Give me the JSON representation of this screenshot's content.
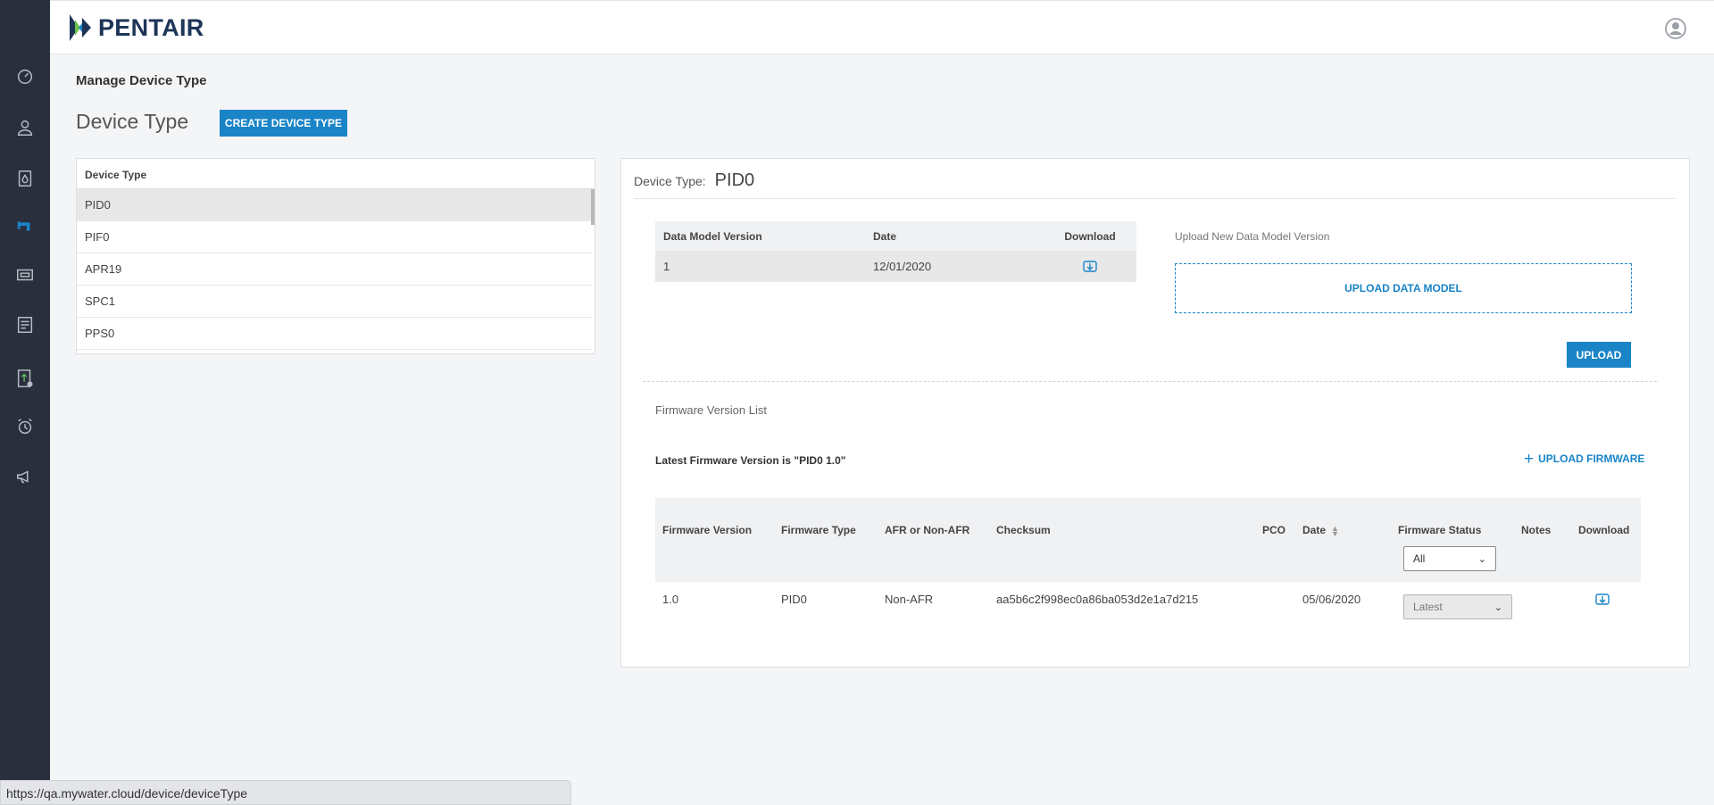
{
  "nav": {
    "items": [
      {
        "icon": "dashboard-gauge-icon"
      },
      {
        "icon": "user-icon"
      },
      {
        "icon": "water-drop-device-icon"
      },
      {
        "icon": "faucet-icon",
        "active": true
      },
      {
        "icon": "device-panel-icon"
      },
      {
        "icon": "checklist-icon"
      },
      {
        "icon": "firmware-upload-icon"
      },
      {
        "icon": "alarm-clock-icon"
      },
      {
        "icon": "megaphone-icon"
      }
    ]
  },
  "header": {
    "brand": "PENTAIR",
    "avatar_icon": "user-circle-icon"
  },
  "page": {
    "breadcrumb": "Manage Device Type",
    "title": "Device Type",
    "create_button": "CREATE DEVICE TYPE"
  },
  "device_list": {
    "header": "Device Type",
    "items": [
      "PID0",
      "PIF0",
      "APR19",
      "SPC1",
      "PPS0"
    ],
    "selected_index": 0
  },
  "detail": {
    "label": "Device Type:",
    "value": "PID0",
    "data_model": {
      "columns": [
        "Data Model Version",
        "Date",
        "Download"
      ],
      "rows": [
        {
          "version": "1",
          "date": "12/01/2020"
        }
      ]
    },
    "upload_label": "Upload New Data Model Version",
    "upload_zone": "UPLOAD DATA MODEL",
    "upload_button": "UPLOAD",
    "firmware_list_label": "Firmware Version List",
    "latest_text": "Latest Firmware Version is \"PID0 1.0\"",
    "upload_firmware": "UPLOAD FIRMWARE",
    "firmware_table": {
      "columns": [
        "Firmware Version",
        "Firmware Type",
        "AFR or Non-AFR",
        "Checksum",
        "PCO",
        "Date",
        "Firmware Status",
        "Notes",
        "Download"
      ],
      "status_filter": "All",
      "rows": [
        {
          "version": "1.0",
          "type": "PID0",
          "afr": "Non-AFR",
          "checksum": "aa5b6c2f998ec0a86ba053d2e1a7d215",
          "pco": "",
          "date": "05/06/2020",
          "status": "Latest",
          "notes": ""
        }
      ]
    }
  },
  "statusbar": {
    "url": "https://qa.mywater.cloud/device/deviceType"
  },
  "colors": {
    "accent": "#1a84c7",
    "rail": "#2a2f3d",
    "brand": "#1d3557"
  }
}
